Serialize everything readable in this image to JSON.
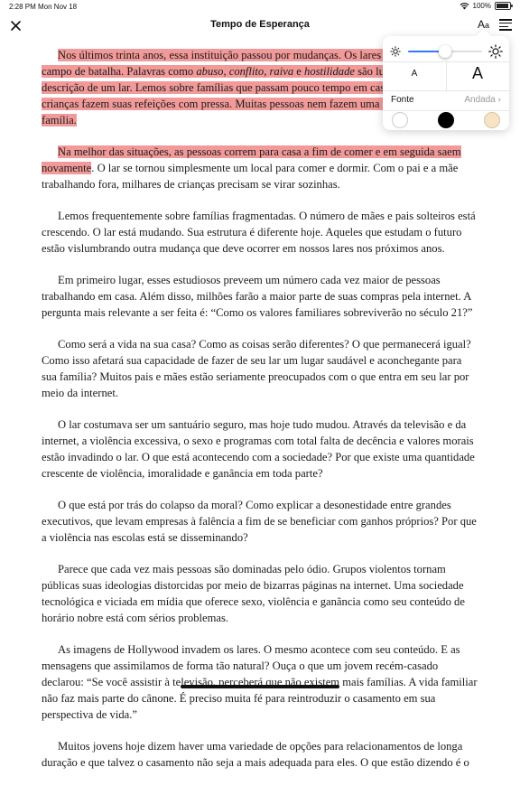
{
  "status": {
    "time": "2:28 PM",
    "date": "Mon Nov 18",
    "battery": "100%"
  },
  "nav": {
    "title": "Tempo de Esperança",
    "aa_label": "A",
    "aa_small": "a"
  },
  "settings": {
    "brightness": 0.5,
    "size_small_label": "A",
    "size_large_label": "A",
    "font_label": "Fonte",
    "font_value": "Andada",
    "themes": [
      {
        "name": "white",
        "color": "#ffffff"
      },
      {
        "name": "black",
        "color": "#000000"
      },
      {
        "name": "sepia",
        "color": "#f8e3c4"
      }
    ],
    "highlight_color": "#f29a9a"
  },
  "content": {
    "p1": {
      "a": "Nos últimos trinta anos, essa instituição passou por mudanças. Os lares de modo geral, um campo de batalha. Palavras como ",
      "i1": "abuso",
      "b": ", ",
      "i2": "conflito",
      "c": ", ",
      "i3": "raiva",
      "d": " e ",
      "i4": "hostilidade",
      "e": " são lugares-comuns na descrição de um lar. Lemos sobre famílias que passam pouco tempo em casa. Em geral, as crianças fazem suas refeições com pressa. Muitas pessoas nem fazem uma única refeição em família."
    },
    "p2": {
      "hl": "Na melhor das situações, as pessoas correm para casa a fim de comer e em seguida saem novamente",
      "rest": ". O lar se tornou simplesmente um local para comer e dormir. Com o pai e a mãe trabalhando fora, milhares de crianças precisam se virar sozinhas."
    },
    "paragraphs": [
      "Lemos frequentemente sobre famílias fragmentadas. O número de mães e pais solteiros está crescendo. O lar está mudando. Sua estrutura é diferente hoje. Aqueles que estudam o futuro estão vislumbrando outra mudança que deve ocorrer em nossos lares nos próximos anos.",
      "Em primeiro lugar, esses estudiosos preveem um número cada vez maior de pessoas trabalhando em casa. Além disso, milhões farão a maior parte de suas compras pela internet. A pergunta mais relevante a ser feita é: “Como os valores familiares sobreviverão no século 21?”",
      "Como será a vida na sua casa? Como as coisas serão diferentes? O que permanecerá igual? Como isso afetará sua capacidade de fazer de seu lar um lugar saudável e aconchegante para sua família? Muitos pais e mães estão seriamente preocupados com o que entra em seu lar por meio da internet.",
      "O lar costumava ser um santuário seguro, mas hoje tudo mudou. Através da televisão e da internet, a violência excessiva, o sexo e programas com total falta de decência e valores morais estão invadindo o lar. O que está acontecendo com a sociedade? Por que existe uma quantidade crescente de violência, imoralidade e ganância em toda parte?",
      "O que está por trás do colapso da moral? Como explicar a desonestidade entre grandes executivos, que levam empresas à falência a fim de se beneficiar com ganhos próprios? Por que a violência nas escolas está se disseminando?",
      "Parece que cada vez mais pessoas são dominadas pelo ódio. Grupos violentos tornam públicas suas ideologias distorcidas por meio de bizarras páginas na internet. Uma sociedade tecnológica e viciada em mídia que oferece sexo, violência e ganância como seu conteúdo de horário nobre está com sérios problemas.",
      "As imagens de Hollywood invadem os lares. O mesmo acontece com seu conteúdo. E as mensagens que assimilamos de forma tão natural? Ouça o que um jovem recém-casado declarou: “Se você assistir à televisão, perceberá que não existem mais famílias. A vida familiar não faz mais parte do cânone. É preciso muita fé para reintroduzir o casamento em sua perspectiva de vida.”",
      "Muitos jovens hoje dizem haver uma variedade de opções para relacionamentos de longa duração e que talvez o casamento não seja a mais adequada para eles. O que estão dizendo é o"
    ]
  }
}
